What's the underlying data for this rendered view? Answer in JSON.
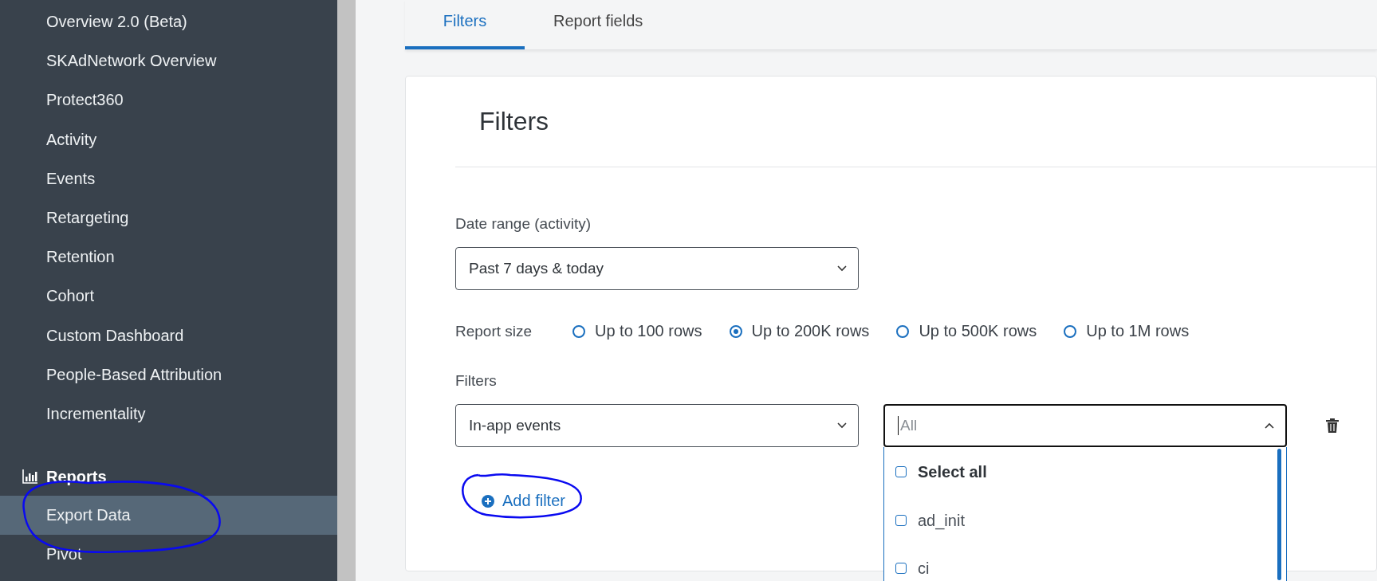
{
  "sidebar": {
    "items": [
      {
        "label": "Overview 2.0 (Beta)",
        "selected": false
      },
      {
        "label": "SKAdNetwork Overview",
        "selected": false
      },
      {
        "label": "Protect360",
        "selected": false
      },
      {
        "label": "Activity",
        "selected": false
      },
      {
        "label": "Events",
        "selected": false
      },
      {
        "label": "Retargeting",
        "selected": false
      },
      {
        "label": "Retention",
        "selected": false
      },
      {
        "label": "Cohort",
        "selected": false
      },
      {
        "label": "Custom Dashboard",
        "selected": false
      },
      {
        "label": "People-Based Attribution",
        "selected": false
      },
      {
        "label": "Incrementality",
        "selected": false
      }
    ],
    "section": {
      "title": "Reports",
      "items": [
        {
          "label": "Export Data",
          "selected": true
        },
        {
          "label": "Pivot",
          "selected": false
        }
      ]
    }
  },
  "tabs": [
    {
      "label": "Filters",
      "selected": true
    },
    {
      "label": "Report fields",
      "selected": false
    }
  ],
  "card": {
    "title": "Filters",
    "date_range": {
      "label": "Date range (activity)",
      "value": "Past 7 days & today"
    },
    "report_size": {
      "label": "Report size",
      "options": [
        {
          "label": "Up to 100 rows",
          "selected": false
        },
        {
          "label": "Up to 200K rows",
          "selected": true
        },
        {
          "label": "Up to 500K rows",
          "selected": false
        },
        {
          "label": "Up to 1M rows",
          "selected": false
        }
      ]
    },
    "filters": {
      "label": "Filters",
      "type_value": "In-app events",
      "values_placeholder": "All",
      "expanded": true,
      "options": [
        {
          "label": "Select all",
          "checked": false
        },
        {
          "label": "ad_init",
          "checked": false
        },
        {
          "label": "ci",
          "checked": false
        }
      ],
      "add_label": "Add filter"
    }
  }
}
